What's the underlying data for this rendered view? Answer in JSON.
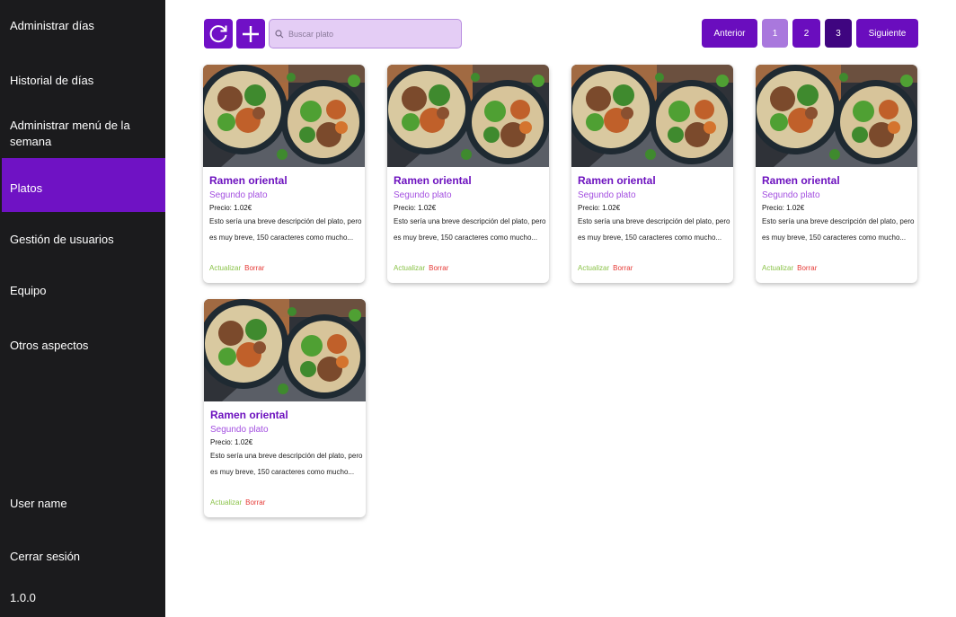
{
  "sidebar": {
    "items": [
      {
        "label": "Administrar días"
      },
      {
        "label": "Historial de días"
      },
      {
        "label": "Administrar menú de la semana"
      },
      {
        "label": "Platos"
      },
      {
        "label": "Gestión de usuarios"
      },
      {
        "label": "Equipo"
      },
      {
        "label": "Otros aspectos"
      }
    ],
    "active_item": "Platos",
    "user_name": "User name",
    "logout": "Cerrar sesión",
    "version": "1.0.0"
  },
  "toolbar": {
    "refresh_icon": "refresh-icon",
    "add_icon": "plus-icon",
    "search_placeholder": "Buscar plato"
  },
  "pagination": {
    "prev_label": "Anterior",
    "pages": [
      "1",
      "2",
      "3"
    ],
    "current_page": "3",
    "next_label": "Siguiente"
  },
  "dishes": [
    {
      "name": "Ramen oriental",
      "category": "Segundo plato",
      "price_label": "Precio:",
      "price": "1.02€",
      "description": "Esto sería una breve descripción del plato, pero es muy breve, 150 caracteres como mucho...",
      "update_label": "Actualizar",
      "delete_label": "Borrar"
    },
    {
      "name": "Ramen oriental",
      "category": "Segundo plato",
      "price_label": "Precio:",
      "price": "1.02€",
      "description": "Esto sería una breve descripción del plato, pero es muy breve, 150 caracteres como mucho...",
      "update_label": "Actualizar",
      "delete_label": "Borrar"
    },
    {
      "name": "Ramen oriental",
      "category": "Segundo plato",
      "price_label": "Precio:",
      "price": "1.02€",
      "description": "Esto sería una breve descripción del plato, pero es muy breve, 150 caracteres como mucho...",
      "update_label": "Actualizar",
      "delete_label": "Borrar"
    },
    {
      "name": "Ramen oriental",
      "category": "Segundo plato",
      "price_label": "Precio:",
      "price": "1.02€",
      "description": "Esto sería una breve descripción del plato, pero es muy breve, 150 caracteres como mucho...",
      "update_label": "Actualizar",
      "delete_label": "Borrar"
    },
    {
      "name": "Ramen oriental",
      "category": "Segundo plato",
      "price_label": "Precio:",
      "price": "1.02€",
      "description": "Esto sería una breve descripción del plato, pero es muy breve, 150 caracteres como mucho...",
      "update_label": "Actualizar",
      "delete_label": "Borrar"
    }
  ],
  "colors": {
    "sidebar_bg": "#1b1b1d",
    "accent": "#6f12c4",
    "search_bg": "#e4cdf5",
    "dish_name": "#6d12bf",
    "dish_category": "#a34fe0",
    "update_link": "#8bc34a",
    "delete_link": "#e53935"
  }
}
